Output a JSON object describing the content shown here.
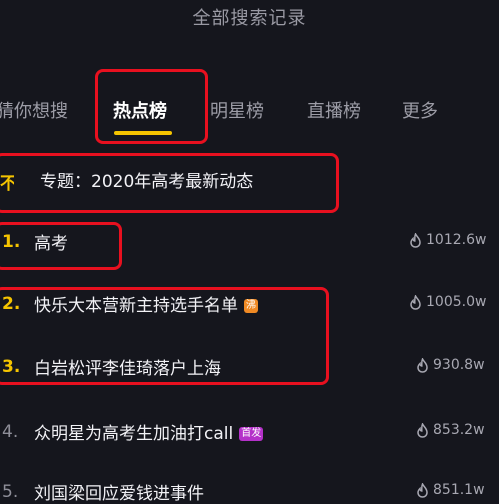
{
  "header": {
    "title": "全部搜索记录"
  },
  "tabs": [
    {
      "label": "猜你想搜"
    },
    {
      "label": "热点榜"
    },
    {
      "label": "明星榜"
    },
    {
      "label": "直播榜"
    },
    {
      "label": "更多"
    }
  ],
  "topic": {
    "rank": "不",
    "text": "专题：2020年高考最新动态"
  },
  "list": [
    {
      "rank": "1.",
      "title": "高考",
      "count": "1012.6w",
      "badge": ""
    },
    {
      "rank": "2.",
      "title": "快乐大本营新主持选手名单",
      "count": "1005.0w",
      "badge": "沸"
    },
    {
      "rank": "3.",
      "title": "白岩松评李佳琦落户上海",
      "count": "930.8w",
      "badge": ""
    },
    {
      "rank": "4.",
      "title": "众明星为高考生加油打call",
      "count": "853.2w",
      "badge": "首发"
    },
    {
      "rank": "5.",
      "title": "刘国梁回应爱钱进事件",
      "count": "851.1w",
      "badge": ""
    }
  ],
  "colors": {
    "background": "#15161d",
    "accent_yellow": "#f5c400",
    "highlight_red": "#e8101f",
    "badge_orange": "#f08a24",
    "badge_purple": "#b431c9"
  },
  "icons": {
    "heat": "flame-icon"
  }
}
